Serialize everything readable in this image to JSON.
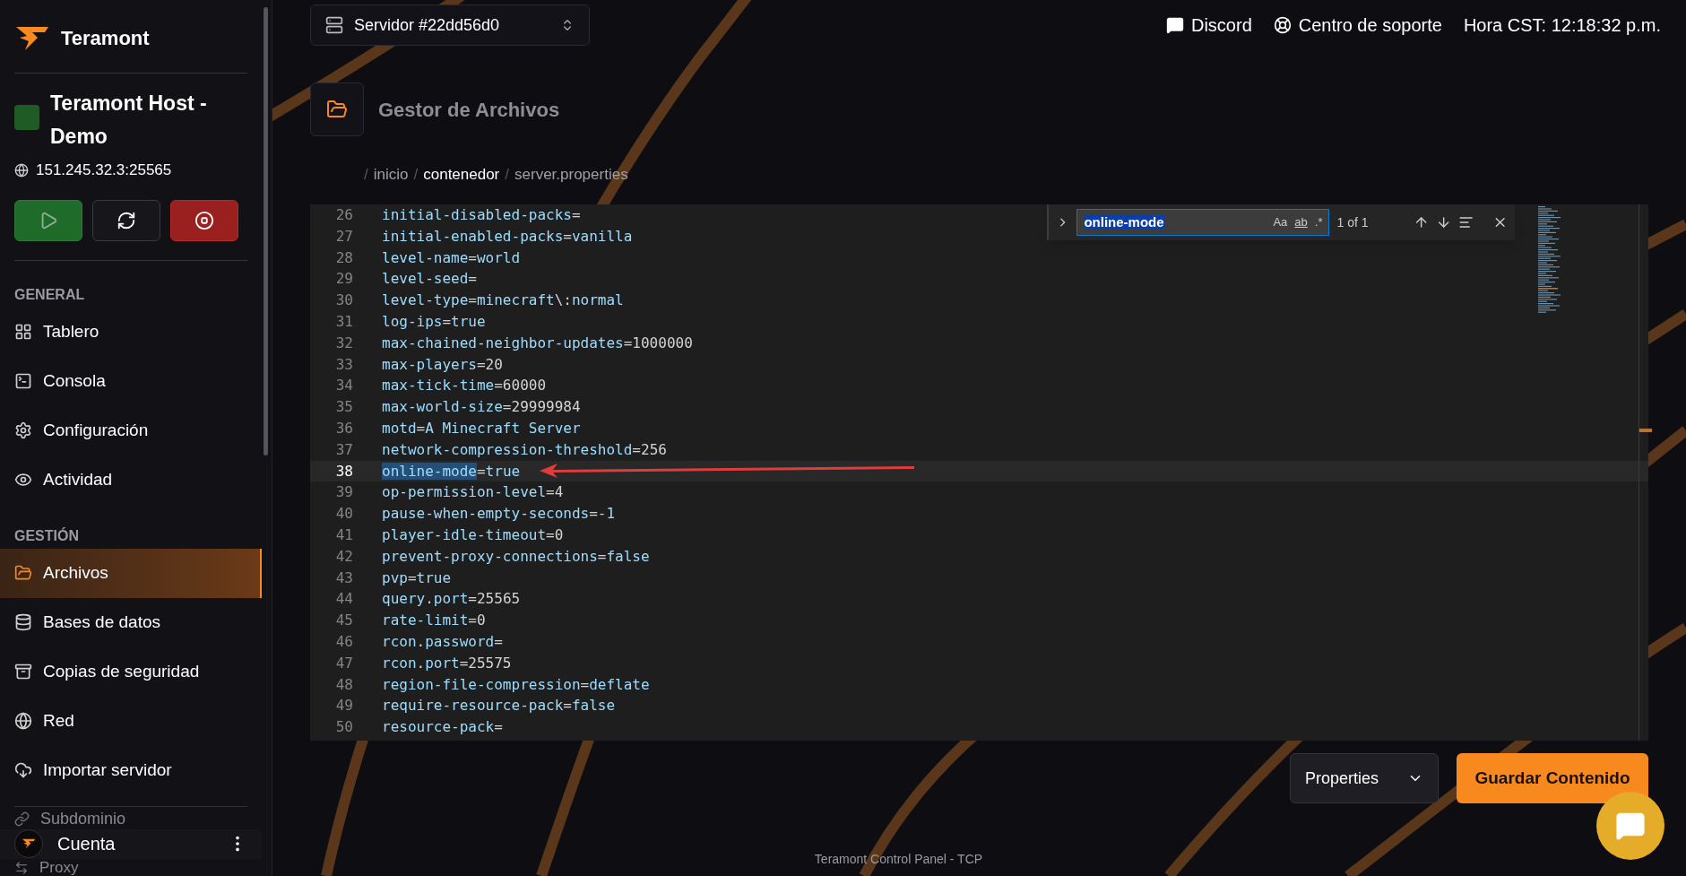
{
  "sidebar": {
    "brand": "Teramont",
    "server": {
      "name": "Teramont Host - Demo",
      "address": "151.245.32.3:25565"
    },
    "power_buttons": [
      {
        "kind": "start",
        "disabled": true
      },
      {
        "kind": "restart",
        "disabled": false
      },
      {
        "kind": "stop",
        "disabled": false
      }
    ],
    "sections": [
      {
        "title": "GENERAL",
        "items": [
          {
            "label": "Tablero",
            "selected": false
          },
          {
            "label": "Consola",
            "selected": false
          },
          {
            "label": "Configuración",
            "selected": false
          },
          {
            "label": "Actividad",
            "selected": false
          }
        ]
      },
      {
        "title": "GESTIÓN",
        "items": [
          {
            "label": "Archivos",
            "selected": true
          },
          {
            "label": "Bases de datos",
            "selected": false
          },
          {
            "label": "Copias de seguridad",
            "selected": false
          },
          {
            "label": "Red",
            "selected": false
          },
          {
            "label": "Importar servidor",
            "selected": false
          },
          {
            "label": "Subdominio",
            "selected": false
          },
          {
            "label": "Proxy",
            "selected": false
          }
        ]
      }
    ],
    "account": {
      "label": "Cuenta"
    }
  },
  "topbar": {
    "server_select": "Servidor #22dd56d0",
    "links": [
      "Discord",
      "Centro de soporte"
    ],
    "clock": "Hora CST: 12:18:32 p.m."
  },
  "page": {
    "title": "Gestor de Archivos",
    "breadcrumb": [
      {
        "separator": "/",
        "label": "inicio",
        "highlighted": false
      },
      {
        "separator": "/",
        "label": "contenedor",
        "highlighted": true
      },
      {
        "separator": "/",
        "label": "server.properties",
        "highlighted": false
      }
    ]
  },
  "editor": {
    "find": {
      "value": "online-mode",
      "options": [
        "Aa",
        "ab",
        ".*"
      ],
      "result": "1 of 1"
    },
    "lines": [
      {
        "number": "26",
        "active": false,
        "tokens": [
          {
            "text": "initial-disabled-packs",
            "kind": "ident",
            "match": false
          },
          {
            "text": "=",
            "kind": "plain",
            "match": false
          }
        ]
      },
      {
        "number": "27",
        "active": false,
        "tokens": [
          {
            "text": "initial-enabled-packs",
            "kind": "ident",
            "match": false
          },
          {
            "text": "=",
            "kind": "plain",
            "match": false
          },
          {
            "text": "vanilla",
            "kind": "ident",
            "match": false
          }
        ]
      },
      {
        "number": "28",
        "active": false,
        "tokens": [
          {
            "text": "level-name",
            "kind": "ident",
            "match": false
          },
          {
            "text": "=",
            "kind": "plain",
            "match": false
          },
          {
            "text": "world",
            "kind": "ident",
            "match": false
          }
        ]
      },
      {
        "number": "29",
        "active": false,
        "tokens": [
          {
            "text": "level-seed",
            "kind": "ident",
            "match": false
          },
          {
            "text": "=",
            "kind": "plain",
            "match": false
          }
        ]
      },
      {
        "number": "30",
        "active": false,
        "tokens": [
          {
            "text": "level-type",
            "kind": "ident",
            "match": false
          },
          {
            "text": "=",
            "kind": "plain",
            "match": false
          },
          {
            "text": "minecraft",
            "kind": "ident",
            "match": false
          },
          {
            "text": "\\:",
            "kind": "plain",
            "match": false
          },
          {
            "text": "normal",
            "kind": "ident",
            "match": false
          }
        ]
      },
      {
        "number": "31",
        "active": false,
        "tokens": [
          {
            "text": "log-ips",
            "kind": "ident",
            "match": false
          },
          {
            "text": "=",
            "kind": "plain",
            "match": false
          },
          {
            "text": "true",
            "kind": "ident",
            "match": false
          }
        ]
      },
      {
        "number": "32",
        "active": false,
        "tokens": [
          {
            "text": "max-chained-neighbor-updates",
            "kind": "ident",
            "match": false
          },
          {
            "text": "=1000000",
            "kind": "plain",
            "match": false
          }
        ]
      },
      {
        "number": "33",
        "active": false,
        "tokens": [
          {
            "text": "max-players",
            "kind": "ident",
            "match": false
          },
          {
            "text": "=20",
            "kind": "plain",
            "match": false
          }
        ]
      },
      {
        "number": "34",
        "active": false,
        "tokens": [
          {
            "text": "max-tick-time",
            "kind": "ident",
            "match": false
          },
          {
            "text": "=60000",
            "kind": "plain",
            "match": false
          }
        ]
      },
      {
        "number": "35",
        "active": false,
        "tokens": [
          {
            "text": "max-world-size",
            "kind": "ident",
            "match": false
          },
          {
            "text": "=29999984",
            "kind": "plain",
            "match": false
          }
        ]
      },
      {
        "number": "36",
        "active": false,
        "tokens": [
          {
            "text": "motd",
            "kind": "ident",
            "match": false
          },
          {
            "text": "=",
            "kind": "plain",
            "match": false
          },
          {
            "text": "A Minecraft Server",
            "kind": "ident",
            "match": false
          }
        ]
      },
      {
        "number": "37",
        "active": false,
        "tokens": [
          {
            "text": "network-compression-threshold",
            "kind": "ident",
            "match": false
          },
          {
            "text": "=256",
            "kind": "plain",
            "match": false
          }
        ]
      },
      {
        "number": "38",
        "active": true,
        "tokens": [
          {
            "text": "online-mode",
            "kind": "ident",
            "match": true
          },
          {
            "text": "=",
            "kind": "plain",
            "match": false
          },
          {
            "text": "true",
            "kind": "ident",
            "match": false
          }
        ]
      },
      {
        "number": "39",
        "active": false,
        "tokens": [
          {
            "text": "op-permission-level",
            "kind": "ident",
            "match": false
          },
          {
            "text": "=4",
            "kind": "plain",
            "match": false
          }
        ]
      },
      {
        "number": "40",
        "active": false,
        "tokens": [
          {
            "text": "pause-when-empty-seconds",
            "kind": "ident",
            "match": false
          },
          {
            "text": "=",
            "kind": "plain",
            "match": false
          },
          {
            "text": "-1",
            "kind": "ident",
            "match": false
          }
        ]
      },
      {
        "number": "41",
        "active": false,
        "tokens": [
          {
            "text": "player-idle-timeout",
            "kind": "ident",
            "match": false
          },
          {
            "text": "=0",
            "kind": "plain",
            "match": false
          }
        ]
      },
      {
        "number": "42",
        "active": false,
        "tokens": [
          {
            "text": "prevent-proxy-connections",
            "kind": "ident",
            "match": false
          },
          {
            "text": "=",
            "kind": "plain",
            "match": false
          },
          {
            "text": "false",
            "kind": "ident",
            "match": false
          }
        ]
      },
      {
        "number": "43",
        "active": false,
        "tokens": [
          {
            "text": "pvp",
            "kind": "ident",
            "match": false
          },
          {
            "text": "=",
            "kind": "plain",
            "match": false
          },
          {
            "text": "true",
            "kind": "ident",
            "match": false
          }
        ]
      },
      {
        "number": "44",
        "active": false,
        "tokens": [
          {
            "text": "query",
            "kind": "ident",
            "match": false
          },
          {
            "text": ".",
            "kind": "plain",
            "match": false
          },
          {
            "text": "port",
            "kind": "ident",
            "match": false
          },
          {
            "text": "=25565",
            "kind": "plain",
            "match": false
          }
        ]
      },
      {
        "number": "45",
        "active": false,
        "tokens": [
          {
            "text": "rate-limit",
            "kind": "ident",
            "match": false
          },
          {
            "text": "=0",
            "kind": "plain",
            "match": false
          }
        ]
      },
      {
        "number": "46",
        "active": false,
        "tokens": [
          {
            "text": "rcon",
            "kind": "ident",
            "match": false
          },
          {
            "text": ".",
            "kind": "plain",
            "match": false
          },
          {
            "text": "password",
            "kind": "ident",
            "match": false
          },
          {
            "text": "=",
            "kind": "plain",
            "match": false
          }
        ]
      },
      {
        "number": "47",
        "active": false,
        "tokens": [
          {
            "text": "rcon",
            "kind": "ident",
            "match": false
          },
          {
            "text": ".",
            "kind": "plain",
            "match": false
          },
          {
            "text": "port",
            "kind": "ident",
            "match": false
          },
          {
            "text": "=25575",
            "kind": "plain",
            "match": false
          }
        ]
      },
      {
        "number": "48",
        "active": false,
        "tokens": [
          {
            "text": "region-file-compression",
            "kind": "ident",
            "match": false
          },
          {
            "text": "=",
            "kind": "plain",
            "match": false
          },
          {
            "text": "deflate",
            "kind": "ident",
            "match": false
          }
        ]
      },
      {
        "number": "49",
        "active": false,
        "tokens": [
          {
            "text": "require-resource-pack",
            "kind": "ident",
            "match": false
          },
          {
            "text": "=",
            "kind": "plain",
            "match": false
          },
          {
            "text": "false",
            "kind": "ident",
            "match": false
          }
        ]
      },
      {
        "number": "50",
        "active": false,
        "tokens": [
          {
            "text": "resource-pack",
            "kind": "ident",
            "match": false
          },
          {
            "text": "=",
            "kind": "plain",
            "match": false
          }
        ]
      }
    ]
  },
  "actions": {
    "language_select": "Properties",
    "save_button": "Guardar Contenido"
  },
  "footer": "Teramont Control Panel - TCP"
}
